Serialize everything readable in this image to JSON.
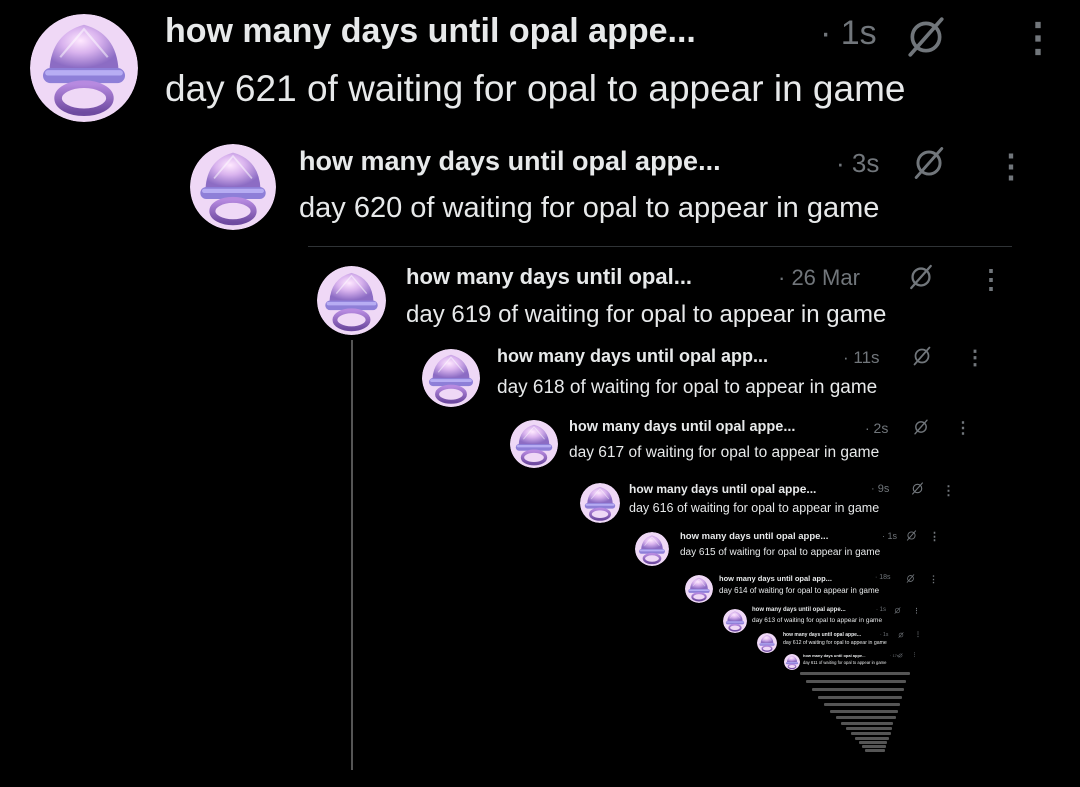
{
  "posts": [
    {
      "author": "how many days until opal appe...",
      "time": "· 1s",
      "text": "day 621 of waiting for opal to appear in game"
    },
    {
      "author": "how many days until opal appe...",
      "time": "· 3s",
      "text": "day 620 of waiting for opal to appear in game"
    },
    {
      "author": "how many days until opal...",
      "time": "· 26 Mar",
      "text": "day 619 of waiting for opal to appear in game"
    },
    {
      "author": "how many days until opal app...",
      "time": "· 11s",
      "text": "day 618 of waiting for opal to appear in game"
    },
    {
      "author": "how many days until opal appe...",
      "time": "· 2s",
      "text": "day 617 of waiting for opal to appear in game"
    },
    {
      "author": "how many days until opal appe...",
      "time": "· 9s",
      "text": "day 616 of waiting for opal to appear in game"
    },
    {
      "author": "how many days until opal appe...",
      "time": "· 1s",
      "text": "day 615 of waiting for opal to appear in game"
    },
    {
      "author": "how many days until opal app...",
      "time": "· 18s",
      "text": "day 614 of waiting for opal to appear in game"
    },
    {
      "author": "how many days until opal appe...",
      "time": "· 1s",
      "text": "day 613 of waiting for opal to appear in game"
    },
    {
      "author": "how many days until opal appe...",
      "time": "· 1s",
      "text": "day 612 of waiting for opal to appear in game"
    },
    {
      "author": "how many days until opal appe...",
      "time": "· 17s",
      "text": "day 611 of waiting for opal to appear in game"
    }
  ],
  "icons": {
    "avatar": "opal-pacifier-avatar",
    "mute": "muted-icon",
    "more": "more-options-icon"
  },
  "colors": {
    "background": "#000000",
    "text": "#e7e9ea",
    "secondary": "#71767b",
    "avatar": "#c9a6e6"
  }
}
